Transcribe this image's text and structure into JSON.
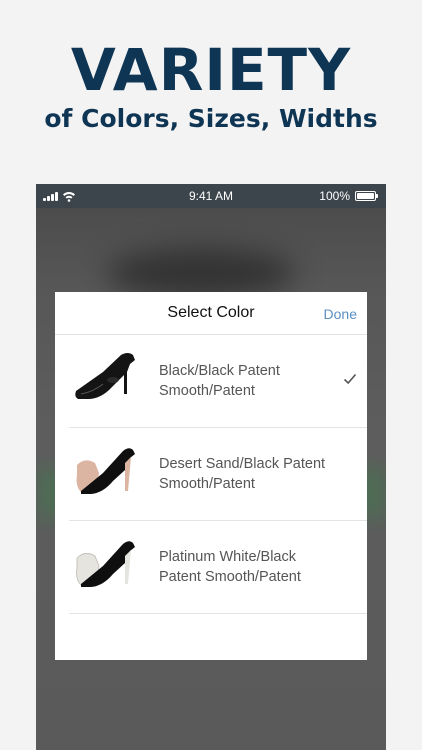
{
  "promo": {
    "title": "VARIETY",
    "subtitle": "of Colors, Sizes, Widths"
  },
  "status_bar": {
    "time": "9:41 AM",
    "battery": "100%"
  },
  "sheet": {
    "title": "Select Color",
    "done_label": "Done",
    "options": [
      {
        "label": "Black/Black Patent Smooth/Patent",
        "selected": true,
        "upper_color": "#141414",
        "heel_color": "#000000"
      },
      {
        "label": "Desert Sand/Black Patent Smooth/Patent",
        "selected": false,
        "upper_color": "#dcb4a2",
        "heel_color": "#0f0f0f"
      },
      {
        "label": "Platinum White/Black Patent Smooth/Patent",
        "selected": false,
        "upper_color": "#e6e4df",
        "heel_color": "#0f0f0f"
      }
    ]
  },
  "colors": {
    "brand": "#0f3554",
    "done": "#5a8fc2"
  }
}
